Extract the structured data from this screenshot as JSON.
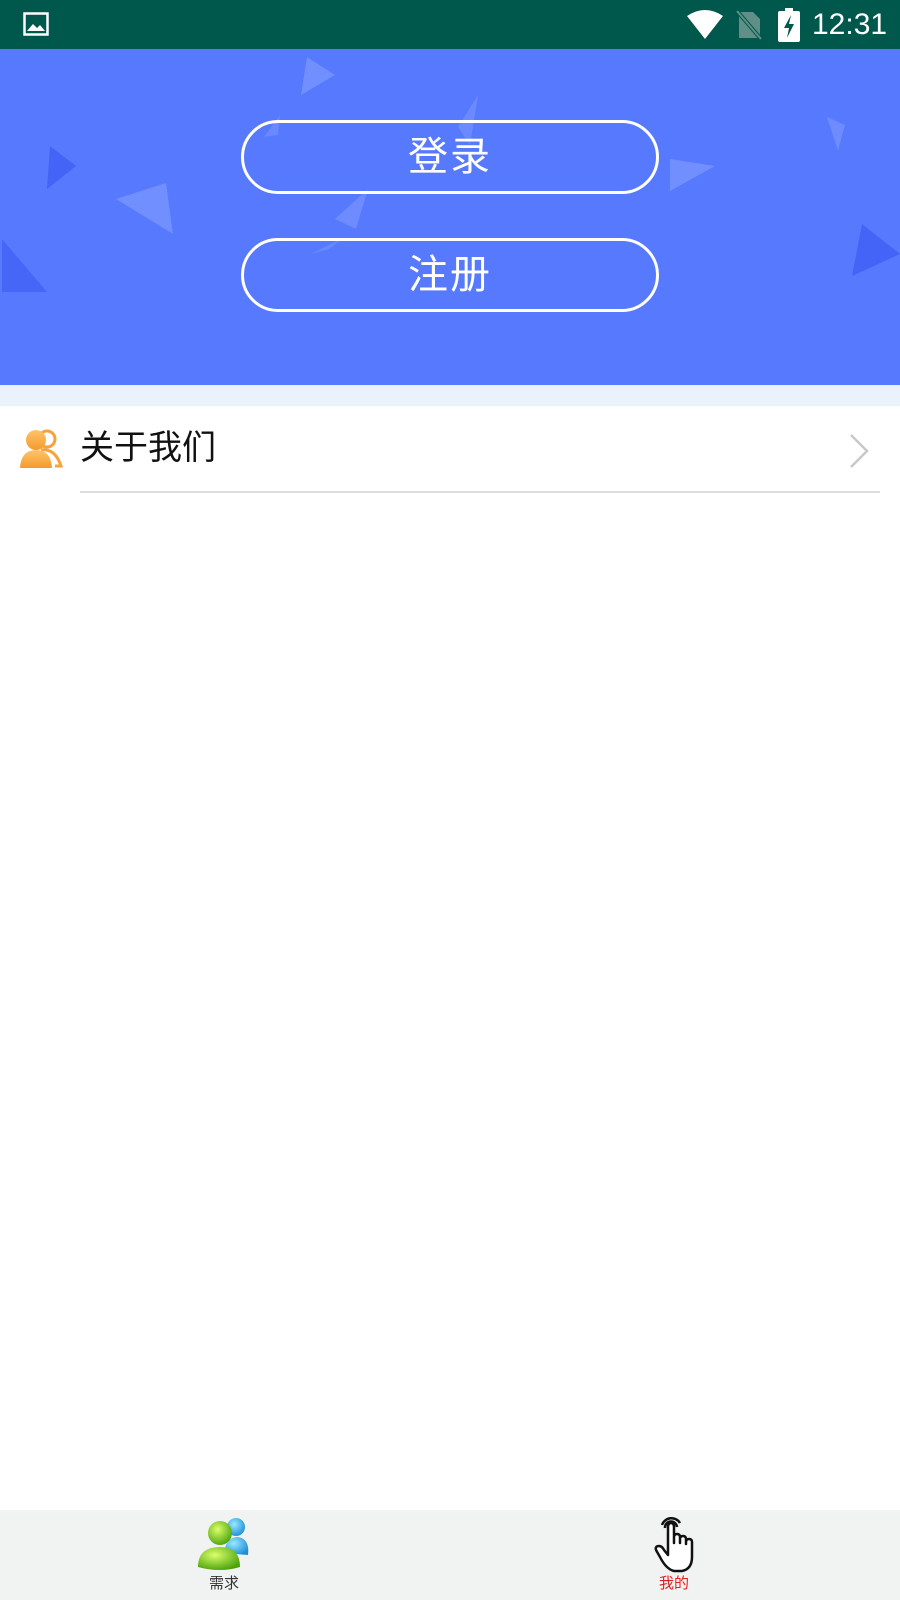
{
  "status_bar": {
    "time": "12:31",
    "icons": [
      "gallery-icon",
      "wifi-icon",
      "no-sim-icon",
      "battery-charging-icon"
    ],
    "background": "#00574b"
  },
  "header": {
    "background": "#5679fe",
    "login_label": "登录",
    "register_label": "注册"
  },
  "menu": {
    "items": [
      {
        "label": "关于我们",
        "icon": "people-icon",
        "icon_color": "#f7a23b"
      }
    ]
  },
  "bottom_nav": {
    "tabs": [
      {
        "label": "需求",
        "icon": "users-icon",
        "active": false
      },
      {
        "label": "我的",
        "icon": "hand-touch-icon",
        "active": true
      }
    ],
    "active_color": "#e02020"
  }
}
